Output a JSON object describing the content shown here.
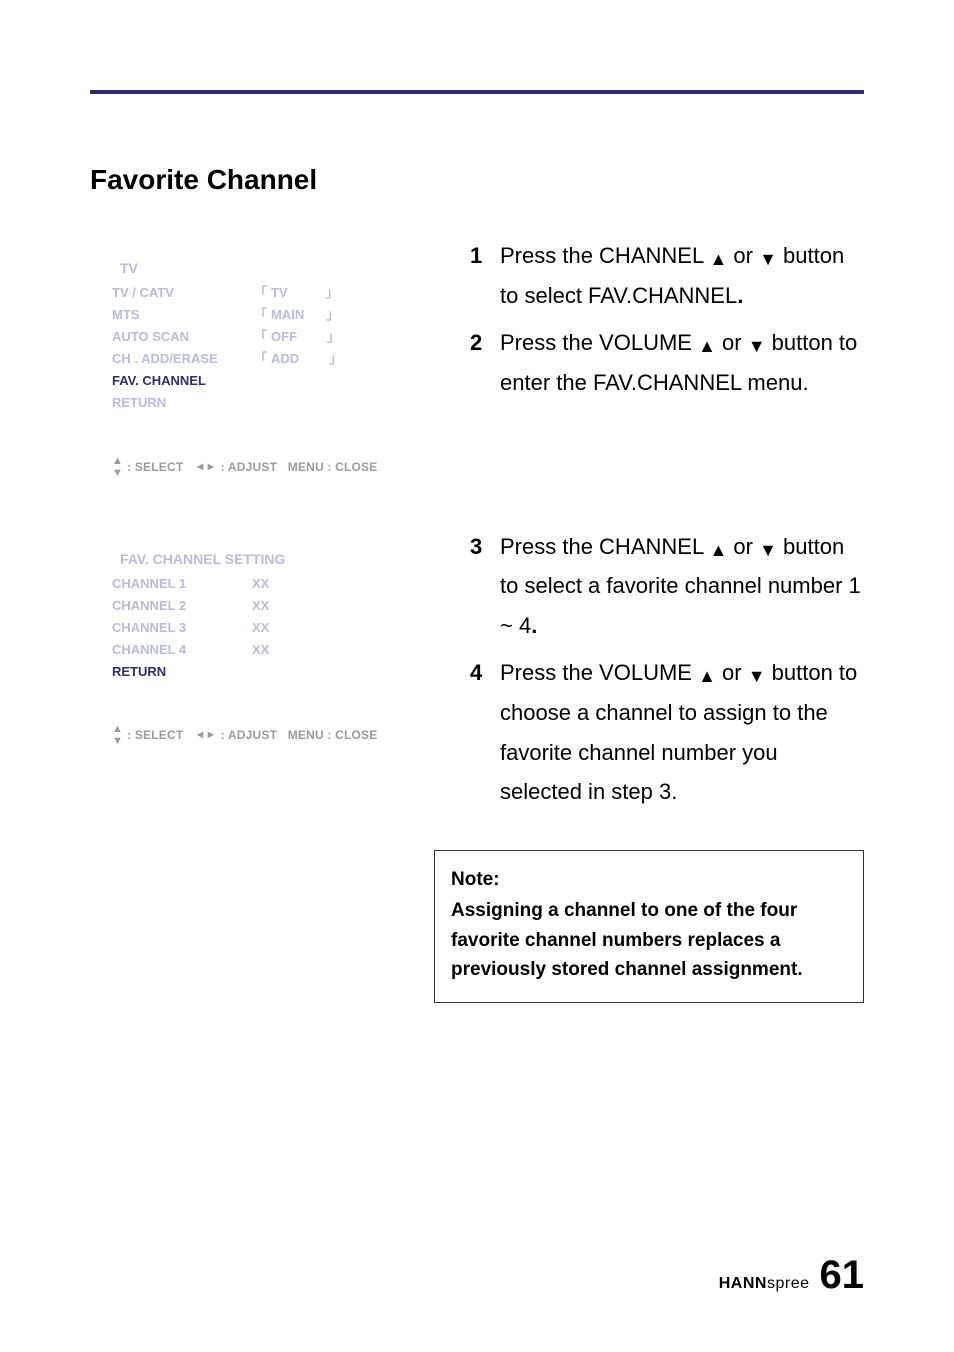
{
  "section_title": "Favorite Channel",
  "osd1": {
    "title": "TV",
    "rows": [
      {
        "label": "TV / CATV",
        "value": "TV",
        "brackets": true,
        "strong": false
      },
      {
        "label": "MTS",
        "value": "MAIN",
        "brackets": true,
        "strong": false
      },
      {
        "label": "AUTO SCAN",
        "value": "OFF",
        "brackets": true,
        "strong": false
      },
      {
        "label": "CH . ADD/ERASE",
        "value": "ADD",
        "brackets": true,
        "strong": false
      },
      {
        "label": "FAV. CHANNEL",
        "value": "",
        "brackets": false,
        "strong": true
      },
      {
        "label": "RETURN",
        "value": "",
        "brackets": false,
        "strong": false
      }
    ],
    "footer": ": SELECT     : ADJUST   MENU : CLOSE"
  },
  "osd2": {
    "title": "FAV. CHANNEL SETTING",
    "rows": [
      {
        "label": "CHANNEL 1",
        "value": "XX",
        "brackets": false,
        "strong": false
      },
      {
        "label": "CHANNEL 2",
        "value": "XX",
        "brackets": false,
        "strong": false
      },
      {
        "label": "CHANNEL 3",
        "value": "XX",
        "brackets": false,
        "strong": false
      },
      {
        "label": "CHANNEL 4",
        "value": "XX",
        "brackets": false,
        "strong": false
      },
      {
        "label": "RETURN",
        "value": "",
        "brackets": false,
        "strong": true
      }
    ],
    "footer": ": SELECT     : ADJUST   MENU : CLOSE"
  },
  "steps_a": [
    {
      "num": "1",
      "text_pre": "Press the CHANNEL ",
      "text_post": " button to select FAV.CHANNEL",
      "trailing_bold_period": true
    },
    {
      "num": "2",
      "text_pre": "Press the VOLUME ",
      "text_post": " button to enter the FAV.CHANNEL menu.",
      "trailing_bold_period": false
    }
  ],
  "steps_b": [
    {
      "num": "3",
      "text_pre": "Press the CHANNEL ",
      "text_post": " button to select a favorite channel number 1 ~ 4",
      "trailing_bold_period": true
    },
    {
      "num": "4",
      "text_pre": "Press the VOLUME ",
      "text_post": " button to choose a channel to assign to the favorite channel number you selected in step 3.",
      "trailing_bold_period": false
    }
  ],
  "arrow_sep": " or ",
  "note": {
    "heading": "Note:",
    "body": "Assigning a channel to one of the four favorite channel numbers replaces a previously stored channel assignment."
  },
  "footer": {
    "brand_bold": "HANN",
    "brand_rest": "spree",
    "page": "61"
  }
}
